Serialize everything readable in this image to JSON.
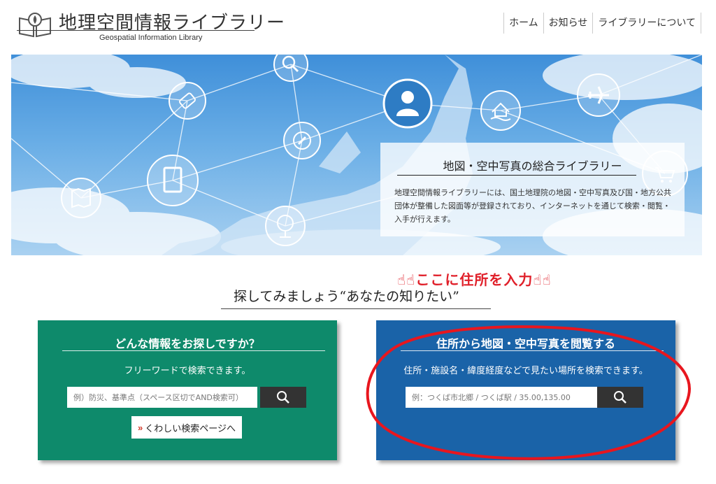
{
  "header": {
    "title": "地理空間情報ライブラリー",
    "subtitle": "Geospatial Information Library",
    "nav": [
      {
        "label": "ホーム"
      },
      {
        "label": "お知らせ"
      },
      {
        "label": "ライブラリーについて"
      }
    ]
  },
  "hero": {
    "title": "地図・空中写真の総合ライブラリー",
    "text": "地理空間情報ライブラリーには、国土地理院の地図・空中写真及び国・地方公共団体が整備した図面等が登録されており、インターネットを通じて検索・閲覧・入手が行えます。"
  },
  "annotation": "☝☝ここに住所を入力☝☝",
  "section": {
    "title": "探してみましょう“あなたの知りたい”"
  },
  "card_keyword": {
    "title": "どんな情報をお探しですか？",
    "description": "フリーワードで検索できます。",
    "placeholder": "例）防災、基準点（スペース区切でAND検索可）",
    "detail_label": "くわしい検索ページへ",
    "detail_chevron": "»"
  },
  "card_address": {
    "title": "住所から地図・空中写真を閲覧する",
    "description": "住所・施設名・緯度経度などで見たい場所を検索できます。",
    "placeholder": "例：つくば市北郷 / つくば駅 / 35.00,135.00"
  },
  "colors": {
    "green_card": "#0e8a6b",
    "blue_card": "#1a63a8",
    "search_button": "#333333",
    "annotation_red": "#e0202a"
  },
  "icons": [
    "book-logo-icon",
    "search-icon",
    "magnifier-icon",
    "scroll-icon",
    "person-icon",
    "house-flood-icon",
    "airplane-icon",
    "compass-icon",
    "book-icon",
    "cart-icon",
    "map-icon",
    "globe-icon"
  ]
}
